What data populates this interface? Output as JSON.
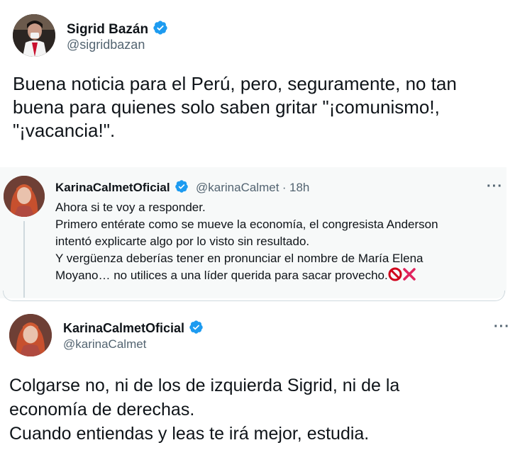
{
  "main_tweet": {
    "display_name": "Sigrid Bazán",
    "handle": "@sigridbazan",
    "text": "Buena noticia para el Perú, pero, seguramente, no tan\nbuena para quienes solo saben gritar \"¡comunismo!,\n\"¡vacancia!\"."
  },
  "quoted_tweet": {
    "display_name": "KarinaCalmetOficial",
    "handle": "@karinaCalmet",
    "separator": "·",
    "time": "18h",
    "more_label": "···",
    "text": "Ahora si te voy a responder.\nPrimero entérate como se mueve la economía, el congresista Anderson\nintentó explicarte algo por lo visto sin resultado.\nY vergüenza deberías tener en pronunciar el nombre de María Elena\nMoyano… no utilices a una líder querida para sacar provecho."
  },
  "reply_tweet": {
    "display_name": "KarinaCalmetOficial",
    "handle": "@karinaCalmet",
    "more_label": "···",
    "text": "Colgarse no, ni de los de izquierda Sigrid, ni de la\neconomía de derechas.\nCuando entiendas y leas te irá mejor, estudia."
  },
  "colors": {
    "verified_blue": "#1d9bf0",
    "secondary_text": "#536471",
    "quoted_background": "#f7f9f9",
    "no_entry_red": "#d0021b",
    "cross_red": "#e0245e"
  },
  "icons": [
    "verified-badge-icon",
    "more-options-icon",
    "no-entry-icon",
    "cross-mark-icon"
  ]
}
